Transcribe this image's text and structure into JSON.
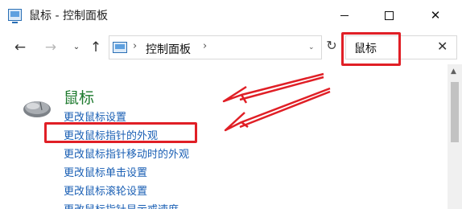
{
  "window": {
    "title": "鼠标 - 控制面板",
    "controls": {
      "minimize": "",
      "maximize": "",
      "close": "✕"
    }
  },
  "nav": {
    "back": "←",
    "forward": "→",
    "history": "⌄",
    "up": "↑",
    "breadcrumb_sep": "›",
    "breadcrumb": [
      "控制面板"
    ],
    "refresh": "↻",
    "search_value": "鼠标",
    "search_clear": "✕"
  },
  "content": {
    "category_title": "鼠标",
    "links": [
      "更改鼠标设置",
      "更改鼠标指针的外观",
      "更改鼠标指针移动时的外观",
      "更改鼠标单击设置",
      "更改鼠标滚轮设置",
      "更改鼠标指针显示或速度"
    ]
  },
  "annotations": {
    "highlight_color": "#e01f26",
    "highlighted_link_index": 1,
    "highlighted_search": true
  },
  "colors": {
    "category_green": "#1e7a2e",
    "link_blue": "#1a5fb4"
  }
}
